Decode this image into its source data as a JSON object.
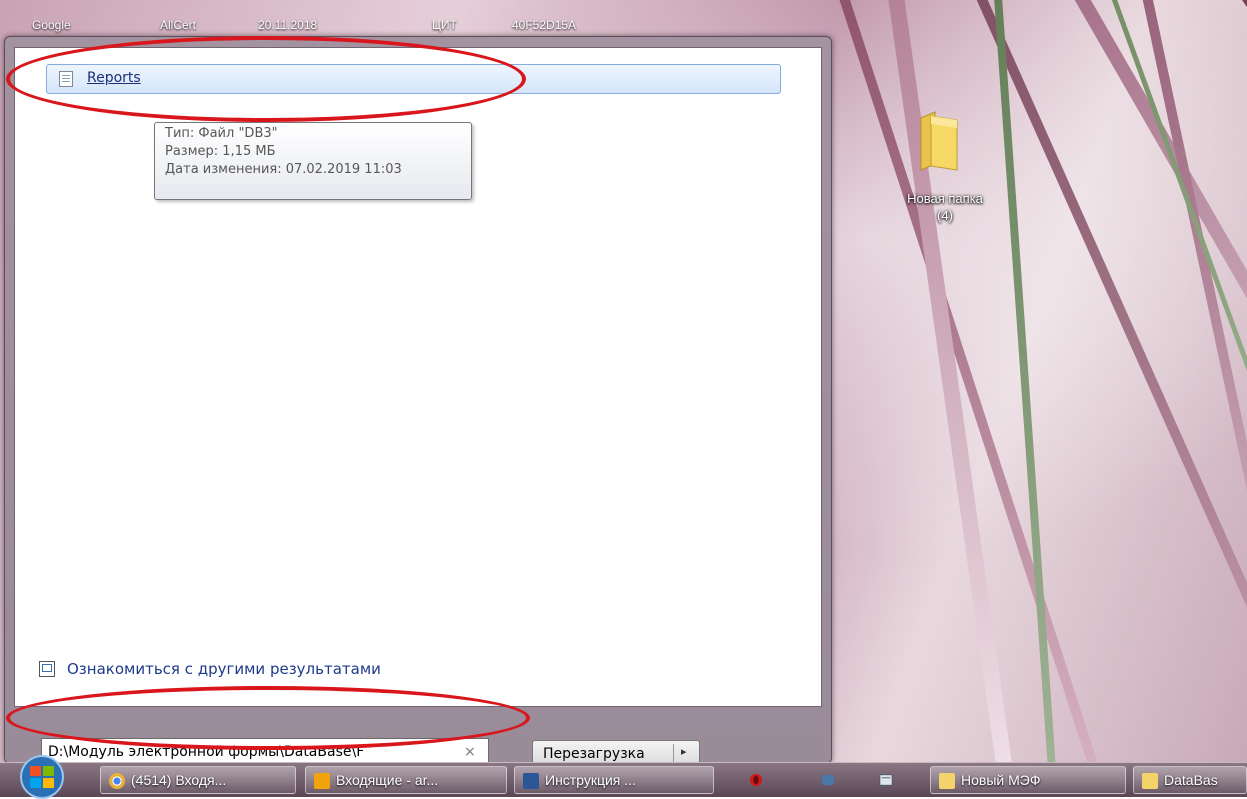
{
  "desktop": {
    "top_icon_labels": [
      "Google",
      "AllCert",
      "20.11.2018",
      "ЦИТ",
      "40F52D15A"
    ],
    "folder": {
      "name": "Новая папка",
      "count": "(4)"
    }
  },
  "start_menu": {
    "results": [
      {
        "label": "Reports"
      }
    ],
    "tooltip": {
      "type_line": "Тип: Файл \"DB3\"",
      "size_line": "Размер: 1,15 МБ",
      "date_line": "Дата изменения: 07.02.2019 11:03"
    },
    "see_more_label": "Ознакомиться с другими результатами",
    "search": {
      "value": "D:\\Модуль электронной формы\\DataBase\\F",
      "clear": "×"
    },
    "shutdown": {
      "label": "Перезагрузка",
      "arrow": "▸"
    }
  },
  "taskbar": {
    "buttons": [
      {
        "label": "(4514) Входя...",
        "icon_color": "#e8b23a"
      },
      {
        "label": "Входящие - ar...",
        "icon_color": "#f0a30a"
      },
      {
        "label": "Инструкция ...",
        "icon_color": "#2b5797"
      },
      {
        "label": "Новый МЭФ",
        "icon_color": "#f4d36a"
      },
      {
        "label": "DataBas",
        "icon_color": "#f4d36a"
      }
    ]
  },
  "colors": {
    "annotation": "#d9161c",
    "link": "#1e3a8a",
    "selection": "#d5e6fa"
  }
}
